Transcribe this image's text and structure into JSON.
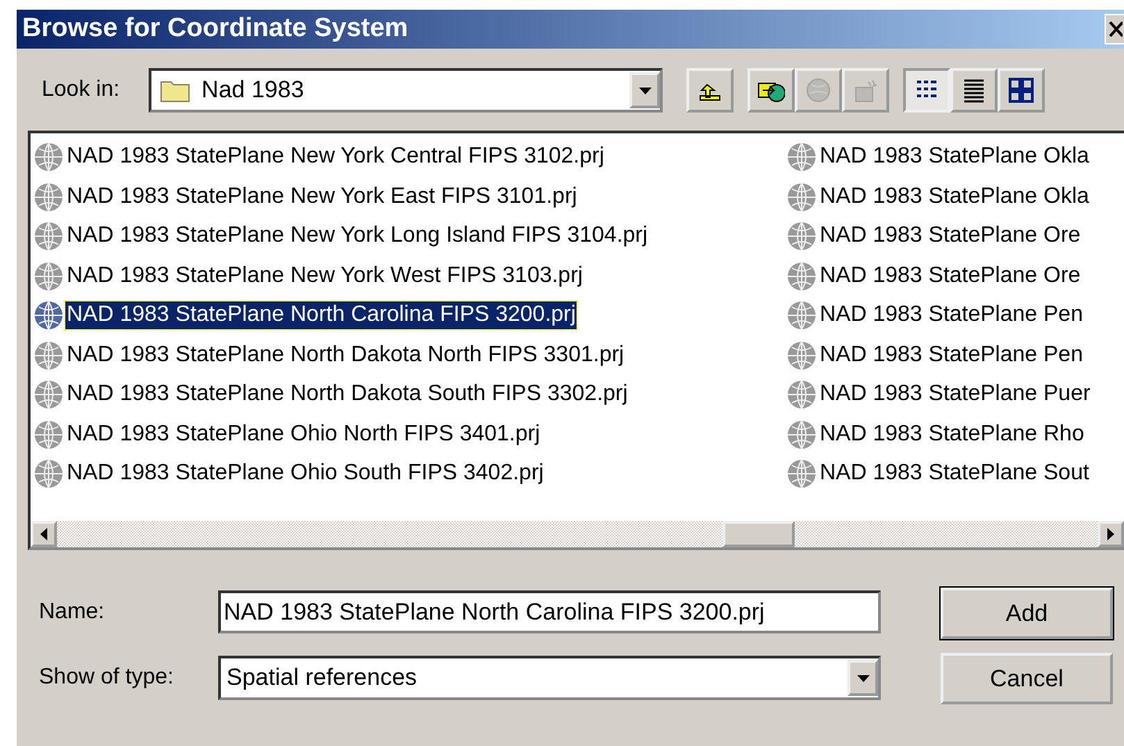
{
  "window": {
    "title": "Browse for Coordinate System"
  },
  "look_in": {
    "label": "Look in:",
    "value": "Nad 1983"
  },
  "toolbar": [
    {
      "kind": "up",
      "disabled": false,
      "selected": false
    },
    {
      "kind": "connect",
      "disabled": false,
      "selected": false
    },
    {
      "kind": "globe",
      "disabled": true,
      "selected": false
    },
    {
      "kind": "new",
      "disabled": true,
      "selected": false
    },
    {
      "kind": "list",
      "disabled": false,
      "selected": true
    },
    {
      "kind": "details",
      "disabled": false,
      "selected": false
    },
    {
      "kind": "icons",
      "disabled": false,
      "selected": false
    }
  ],
  "files": [
    [
      {
        "name": "NAD 1983 StatePlane New York Central FIPS 3102.prj",
        "selected": false
      },
      {
        "name": "NAD 1983 StatePlane New York East FIPS 3101.prj",
        "selected": false
      },
      {
        "name": "NAD 1983 StatePlane New York Long Island FIPS 3104.prj",
        "selected": false
      },
      {
        "name": "NAD 1983 StatePlane New York West FIPS 3103.prj",
        "selected": false
      },
      {
        "name": "NAD 1983 StatePlane North Carolina FIPS 3200.prj",
        "selected": true
      },
      {
        "name": "NAD 1983 StatePlane North Dakota North FIPS 3301.prj",
        "selected": false
      },
      {
        "name": "NAD 1983 StatePlane North Dakota South FIPS 3302.prj",
        "selected": false
      },
      {
        "name": "NAD 1983 StatePlane Ohio North FIPS 3401.prj",
        "selected": false
      },
      {
        "name": "NAD 1983 StatePlane Ohio South FIPS 3402.prj",
        "selected": false
      }
    ],
    [
      {
        "name": "NAD 1983 StatePlane Okla",
        "selected": false
      },
      {
        "name": "NAD 1983 StatePlane Okla",
        "selected": false
      },
      {
        "name": "NAD 1983 StatePlane Ore",
        "selected": false
      },
      {
        "name": "NAD 1983 StatePlane Ore",
        "selected": false
      },
      {
        "name": "NAD 1983 StatePlane Pen",
        "selected": false
      },
      {
        "name": "NAD 1983 StatePlane Pen",
        "selected": false
      },
      {
        "name": "NAD 1983 StatePlane Puer",
        "selected": false
      },
      {
        "name": "NAD 1983 StatePlane Rho",
        "selected": false
      },
      {
        "name": "NAD 1983 StatePlane Sout",
        "selected": false
      }
    ]
  ],
  "name_field": {
    "label": "Name:",
    "value": "NAD 1983 StatePlane North Carolina FIPS 3200.prj"
  },
  "type_field": {
    "label": "Show of type:",
    "value": "Spatial references"
  },
  "buttons": [
    "Add",
    "Cancel"
  ]
}
